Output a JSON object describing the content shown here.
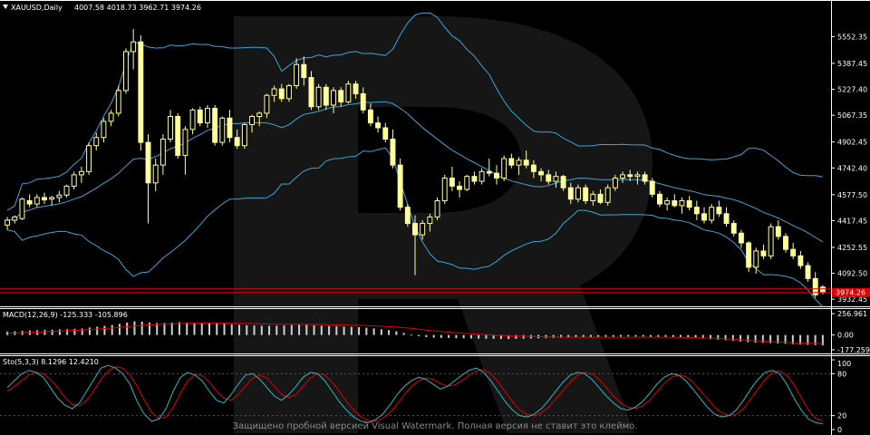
{
  "header": {
    "symbol_label": "XAUUSD,Daily",
    "ohlc_label": "4007.58 4018.73 3962.71 3974.26"
  },
  "macd_header": {
    "label": "MACD(12,26,9) -125.333 -105.896"
  },
  "stoch_header": {
    "label": "Sto(5,3,3) 8.1296 12.4210"
  },
  "watermark": "Защищено пробной версией Visual Watermark. Полная версия не ставит это клеймо.",
  "colors": {
    "background": "#000000",
    "bull": "#ffff99",
    "bear": "#ffff99",
    "band": "#3aa6d8",
    "macd_hist": "#d0d0d0",
    "macd_signal": "#e00000",
    "stoch_main": "#2fb7c0",
    "stoch_signal": "#e00000",
    "price_tag": "#e00000",
    "text": "#ffffff"
  },
  "chart_data": [
    {
      "type": "candlestick",
      "title": "XAUUSD,Daily",
      "ylim": [
        3900,
        5700
      ],
      "y_ticks": [
        "5552.35",
        "5387.45",
        "5227.40",
        "5067.35",
        "4902.45",
        "4742.40",
        "4577.50",
        "4417.45",
        "4252.55",
        "4092.50",
        "3932.45"
      ],
      "current_price_label": "3974.26",
      "ohlc": [
        [
          4390,
          4440,
          4360,
          4420
        ],
        [
          4420,
          4450,
          4400,
          4440
        ],
        [
          4430,
          4560,
          4420,
          4550
        ],
        [
          4540,
          4580,
          4500,
          4520
        ],
        [
          4520,
          4580,
          4500,
          4560
        ],
        [
          4560,
          4590,
          4520,
          4545
        ],
        [
          4550,
          4570,
          4510,
          4560
        ],
        [
          4560,
          4600,
          4530,
          4575
        ],
        [
          4575,
          4640,
          4560,
          4630
        ],
        [
          4630,
          4720,
          4610,
          4700
        ],
        [
          4700,
          4750,
          4650,
          4720
        ],
        [
          4720,
          4900,
          4700,
          4880
        ],
        [
          4880,
          4960,
          4850,
          4930
        ],
        [
          4930,
          5050,
          4900,
          5030
        ],
        [
          5030,
          5100,
          5000,
          5080
        ],
        [
          5080,
          5250,
          5060,
          5220
        ],
        [
          5220,
          5480,
          5200,
          5460
        ],
        [
          5460,
          5600,
          5350,
          5520
        ],
        [
          5520,
          5560,
          4850,
          4900
        ],
        [
          4900,
          4950,
          4400,
          4650
        ],
        [
          4650,
          4800,
          4600,
          4760
        ],
        [
          4760,
          4950,
          4700,
          4920
        ],
        [
          4920,
          5100,
          4900,
          5060
        ],
        [
          5060,
          5080,
          4800,
          4820
        ],
        [
          4820,
          5000,
          4700,
          4980
        ],
        [
          4980,
          5110,
          4950,
          5100
        ],
        [
          5100,
          5120,
          5000,
          5020
        ],
        [
          5020,
          5130,
          4990,
          5110
        ],
        [
          5110,
          5130,
          4880,
          4900
        ],
        [
          4900,
          5060,
          4880,
          5050
        ],
        [
          5050,
          5100,
          4900,
          4930
        ],
        [
          4930,
          4980,
          4860,
          4880
        ],
        [
          4880,
          5020,
          4860,
          5010
        ],
        [
          5010,
          5070,
          4960,
          5060
        ],
        [
          5060,
          5090,
          5000,
          5080
        ],
        [
          5080,
          5200,
          5050,
          5190
        ],
        [
          5190,
          5250,
          5150,
          5230
        ],
        [
          5230,
          5260,
          5150,
          5170
        ],
        [
          5170,
          5260,
          5150,
          5250
        ],
        [
          5250,
          5420,
          5230,
          5380
        ],
        [
          5380,
          5430,
          5250,
          5300
        ],
        [
          5300,
          5340,
          5100,
          5120
        ],
        [
          5120,
          5260,
          5100,
          5240
        ],
        [
          5240,
          5260,
          5100,
          5130
        ],
        [
          5130,
          5240,
          5080,
          5220
        ],
        [
          5220,
          5240,
          5120,
          5150
        ],
        [
          5150,
          5280,
          5140,
          5260
        ],
        [
          5260,
          5280,
          5170,
          5200
        ],
        [
          5200,
          5240,
          5080,
          5100
        ],
        [
          5100,
          5140,
          5000,
          5020
        ],
        [
          5020,
          5060,
          4960,
          4990
        ],
        [
          4990,
          5020,
          4900,
          4920
        ],
        [
          4920,
          4980,
          4740,
          4760
        ],
        [
          4760,
          4800,
          4480,
          4500
        ],
        [
          4500,
          4520,
          4380,
          4400
        ],
        [
          4400,
          4450,
          4080,
          4330
        ],
        [
          4330,
          4420,
          4300,
          4400
        ],
        [
          4400,
          4460,
          4350,
          4440
        ],
        [
          4440,
          4560,
          4420,
          4540
        ],
        [
          4540,
          4700,
          4520,
          4680
        ],
        [
          4680,
          4750,
          4600,
          4630
        ],
        [
          4630,
          4660,
          4560,
          4610
        ],
        [
          4610,
          4700,
          4600,
          4690
        ],
        [
          4690,
          4720,
          4640,
          4660
        ],
        [
          4660,
          4740,
          4640,
          4720
        ],
        [
          4720,
          4800,
          4690,
          4710
        ],
        [
          4710,
          4760,
          4640,
          4680
        ],
        [
          4680,
          4820,
          4660,
          4800
        ],
        [
          4800,
          4830,
          4740,
          4760
        ],
        [
          4760,
          4810,
          4700,
          4790
        ],
        [
          4790,
          4850,
          4740,
          4760
        ],
        [
          4760,
          4790,
          4680,
          4720
        ],
        [
          4720,
          4740,
          4660,
          4700
        ],
        [
          4700,
          4730,
          4640,
          4660
        ],
        [
          4660,
          4720,
          4620,
          4690
        ],
        [
          4690,
          4700,
          4600,
          4620
        ],
        [
          4620,
          4650,
          4520,
          4550
        ],
        [
          4550,
          4640,
          4530,
          4620
        ],
        [
          4620,
          4640,
          4520,
          4540
        ],
        [
          4540,
          4600,
          4510,
          4580
        ],
        [
          4580,
          4610,
          4520,
          4530
        ],
        [
          4530,
          4640,
          4510,
          4620
        ],
        [
          4620,
          4700,
          4600,
          4680
        ],
        [
          4680,
          4720,
          4650,
          4700
        ],
        [
          4700,
          4730,
          4660,
          4690
        ],
        [
          4690,
          4720,
          4640,
          4700
        ],
        [
          4700,
          4720,
          4640,
          4660
        ],
        [
          4660,
          4680,
          4560,
          4580
        ],
        [
          4580,
          4600,
          4500,
          4520
        ],
        [
          4520,
          4560,
          4480,
          4540
        ],
        [
          4540,
          4580,
          4500,
          4510
        ],
        [
          4510,
          4560,
          4460,
          4540
        ],
        [
          4540,
          4570,
          4480,
          4500
        ],
        [
          4500,
          4540,
          4420,
          4460
        ],
        [
          4460,
          4500,
          4400,
          4420
        ],
        [
          4420,
          4520,
          4400,
          4500
        ],
        [
          4500,
          4540,
          4440,
          4460
        ],
        [
          4460,
          4500,
          4380,
          4400
        ],
        [
          4400,
          4420,
          4320,
          4340
        ],
        [
          4340,
          4360,
          4250,
          4280
        ],
        [
          4280,
          4290,
          4100,
          4130
        ],
        [
          4130,
          4250,
          4090,
          4230
        ],
        [
          4230,
          4270,
          4180,
          4200
        ],
        [
          4200,
          4400,
          4180,
          4380
        ],
        [
          4380,
          4420,
          4300,
          4320
        ],
        [
          4320,
          4340,
          4220,
          4240
        ],
        [
          4240,
          4280,
          4180,
          4200
        ],
        [
          4200,
          4230,
          4120,
          4140
        ],
        [
          4140,
          4160,
          4040,
          4060
        ],
        [
          4060,
          4100,
          3940,
          3960
        ],
        [
          4007.58,
          4018.73,
          3962.71,
          3974.26
        ]
      ]
    },
    {
      "type": "bar",
      "title": "MACD(12,26,9)",
      "ylim": [
        -200,
        280
      ],
      "y_ticks": [
        "256.961",
        "0.00",
        "-177.259"
      ],
      "series": [
        {
          "name": "MACD",
          "values": [
            40,
            45,
            50,
            55,
            58,
            62,
            64,
            68,
            70,
            74,
            78,
            90,
            100,
            110,
            120,
            135,
            150,
            165,
            160,
            150,
            145,
            145,
            150,
            155,
            150,
            148,
            150,
            150,
            140,
            135,
            128,
            122,
            118,
            115,
            112,
            110,
            112,
            115,
            120,
            124,
            122,
            116,
            112,
            108,
            104,
            100,
            98,
            94,
            88,
            80,
            70,
            60,
            45,
            25,
            5,
            -15,
            -25,
            -32,
            -35,
            -35,
            -38,
            -40,
            -42,
            -44,
            -45,
            -46,
            -48,
            -48,
            -46,
            -44,
            -42,
            -40,
            -38,
            -36,
            -34,
            -32,
            -30,
            -28,
            -26,
            -24,
            -24,
            -22,
            -20,
            -18,
            -18,
            -18,
            -20,
            -22,
            -24,
            -26,
            -30,
            -34,
            -38,
            -44,
            -50,
            -56,
            -62,
            -70,
            -78,
            -86,
            -90,
            -94,
            -98,
            -102,
            -106,
            -110,
            -114,
            -118,
            -121,
            -125.333
          ]
        },
        {
          "name": "Signal",
          "values": [
            20,
            24,
            28,
            32,
            36,
            40,
            44,
            48,
            52,
            56,
            60,
            66,
            72,
            78,
            84,
            92,
            100,
            108,
            116,
            122,
            126,
            130,
            134,
            137,
            140,
            142,
            144,
            145,
            145,
            144,
            143,
            141,
            139,
            137,
            135,
            133,
            131,
            130,
            129,
            128,
            128,
            127,
            126,
            124,
            122,
            120,
            118,
            116,
            113,
            110,
            106,
            101,
            95,
            88,
            80,
            70,
            60,
            50,
            42,
            35,
            28,
            22,
            16,
            10,
            5,
            0,
            -4,
            -8,
            -12,
            -15,
            -18,
            -20,
            -22,
            -24,
            -25,
            -26,
            -27,
            -27,
            -27,
            -27,
            -27,
            -27,
            -26,
            -26,
            -25,
            -25,
            -25,
            -25,
            -26,
            -27,
            -28,
            -30,
            -32,
            -35,
            -38,
            -42,
            -46,
            -51,
            -56,
            -62,
            -68,
            -74,
            -79,
            -84,
            -88,
            -92,
            -96,
            -99,
            -102,
            -105.896
          ]
        }
      ]
    },
    {
      "type": "line",
      "title": "Sto(5,3,3)",
      "ylim": [
        0,
        100
      ],
      "y_ticks": [
        "100",
        "80",
        "20",
        "0"
      ],
      "series": [
        {
          "name": "Main",
          "values": [
            60,
            70,
            80,
            85,
            82,
            75,
            60,
            45,
            35,
            30,
            38,
            55,
            72,
            88,
            92,
            88,
            80,
            65,
            40,
            22,
            12,
            15,
            30,
            55,
            75,
            82,
            78,
            70,
            55,
            42,
            38,
            50,
            65,
            78,
            80,
            72,
            60,
            48,
            42,
            50,
            62,
            75,
            82,
            80,
            70,
            55,
            40,
            28,
            18,
            12,
            10,
            14,
            22,
            35,
            50,
            62,
            70,
            75,
            72,
            65,
            58,
            62,
            70,
            78,
            85,
            88,
            82,
            70,
            55,
            40,
            28,
            20,
            18,
            22,
            30,
            42,
            55,
            68,
            78,
            82,
            80,
            72,
            60,
            48,
            38,
            30,
            28,
            32,
            40,
            52,
            65,
            75,
            80,
            78,
            70,
            58,
            45,
            32,
            22,
            18,
            20,
            28,
            42,
            58,
            72,
            82,
            85,
            80,
            65,
            45,
            28,
            15,
            10,
            8.13
          ]
        },
        {
          "name": "Signal",
          "values": [
            55,
            62,
            70,
            78,
            82,
            80,
            72,
            60,
            46,
            36,
            34,
            42,
            56,
            72,
            84,
            90,
            88,
            78,
            62,
            42,
            25,
            16,
            18,
            32,
            52,
            70,
            78,
            78,
            68,
            55,
            45,
            42,
            50,
            62,
            74,
            78,
            74,
            62,
            50,
            46,
            50,
            62,
            74,
            80,
            78,
            68,
            55,
            40,
            28,
            18,
            13,
            12,
            16,
            24,
            36,
            50,
            62,
            70,
            74,
            72,
            66,
            62,
            64,
            70,
            78,
            84,
            86,
            80,
            68,
            54,
            40,
            28,
            22,
            20,
            24,
            32,
            44,
            56,
            68,
            78,
            82,
            80,
            72,
            60,
            48,
            38,
            32,
            30,
            34,
            42,
            54,
            66,
            75,
            78,
            76,
            68,
            56,
            44,
            32,
            24,
            20,
            22,
            30,
            44,
            58,
            72,
            82,
            84,
            78,
            64,
            46,
            28,
            16,
            12.42
          ]
        }
      ]
    }
  ]
}
